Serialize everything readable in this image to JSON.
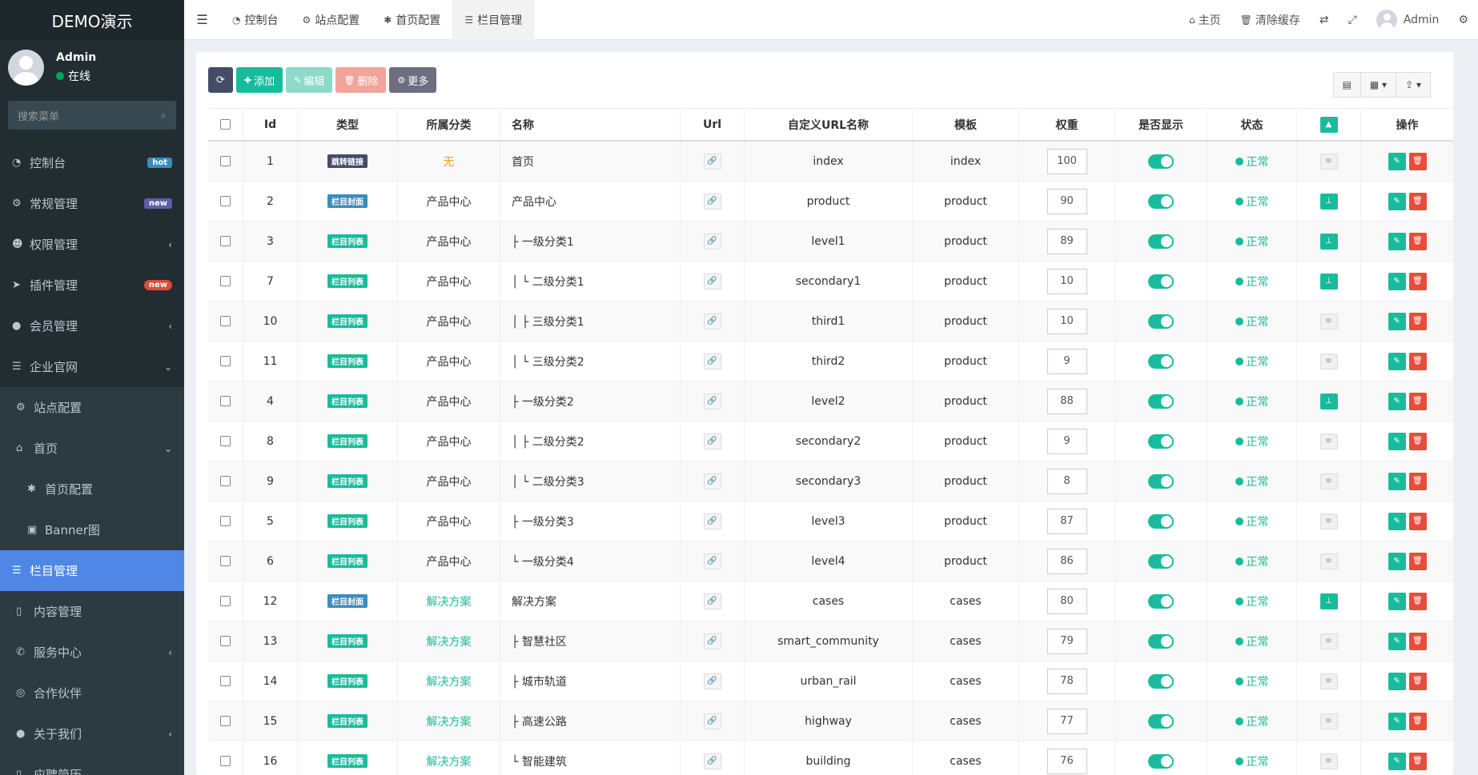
{
  "app": {
    "logo": "DEMO演示"
  },
  "user": {
    "name": "Admin",
    "status": "在线"
  },
  "search": {
    "placeholder": "搜索菜单"
  },
  "menu": [
    {
      "icon": "dashboard-icon",
      "glyph": "◔",
      "label": "控制台",
      "badge": "hot",
      "badge_color": "#3c8dbc",
      "type": "top"
    },
    {
      "icon": "cogs-icon",
      "glyph": "⚙",
      "label": "常规管理",
      "badge": "new",
      "badge_color": "#605ca8",
      "type": "top"
    },
    {
      "icon": "users-icon",
      "glyph": "☻",
      "label": "权限管理",
      "arrow": "‹",
      "type": "top"
    },
    {
      "icon": "rocket-icon",
      "glyph": "➤",
      "label": "插件管理",
      "badge": "new",
      "badge_color": "#dd4b39",
      "type": "top"
    },
    {
      "icon": "user-circle-icon",
      "glyph": "●",
      "label": "会员管理",
      "arrow": "‹",
      "type": "top"
    },
    {
      "icon": "list-icon",
      "glyph": "☰",
      "label": "企业官网",
      "arrow": "⌄",
      "type": "top-open"
    },
    {
      "icon": "cogs-icon",
      "glyph": "⚙",
      "label": "站点配置",
      "type": "sub"
    },
    {
      "icon": "home-icon",
      "glyph": "⌂",
      "label": "首页",
      "arrow": "⌄",
      "type": "sub"
    },
    {
      "icon": "gear-icon",
      "glyph": "✱",
      "label": "首页配置",
      "type": "sub2"
    },
    {
      "icon": "image-icon",
      "glyph": "▣",
      "label": "Banner图",
      "type": "sub2"
    },
    {
      "icon": "list-icon",
      "glyph": "☰",
      "label": "栏目管理",
      "type": "active"
    },
    {
      "icon": "file-icon",
      "glyph": "▯",
      "label": "内容管理",
      "type": "sub"
    },
    {
      "icon": "phone-icon",
      "glyph": "✆",
      "label": "服务中心",
      "arrow": "‹",
      "type": "sub"
    },
    {
      "icon": "handshake-icon",
      "glyph": "◎",
      "label": "合作伙伴",
      "type": "sub"
    },
    {
      "icon": "user-circle-icon",
      "glyph": "●",
      "label": "关于我们",
      "arrow": "‹",
      "type": "sub"
    },
    {
      "icon": "file-icon",
      "glyph": "▯",
      "label": "应聘简历",
      "type": "sub"
    }
  ],
  "topbar": {
    "tabs": [
      {
        "icon": "dashboard-icon",
        "glyph": "◔",
        "label": "控制台"
      },
      {
        "icon": "cogs-icon",
        "glyph": "⚙",
        "label": "站点配置"
      },
      {
        "icon": "gear-icon",
        "glyph": "✱",
        "label": "首页配置"
      },
      {
        "icon": "list-icon",
        "glyph": "☰",
        "label": "栏目管理",
        "active": true
      }
    ],
    "home": "主页",
    "clear_cache": "清除缓存",
    "admin": "Admin"
  },
  "toolbar": {
    "add": "添加",
    "edit": "编辑",
    "delete": "删除",
    "more": "更多"
  },
  "table": {
    "headers": [
      "Id",
      "类型",
      "所属分类",
      "名称",
      "Url",
      "自定义URL名称",
      "模板",
      "权重",
      "是否显示",
      "状态",
      "操作"
    ],
    "rows": [
      {
        "id": "1",
        "type": "跳转链接",
        "type_style": "dark",
        "category": "无",
        "cat_style": "none",
        "name": "首页",
        "url_name": "index",
        "template": "index",
        "weight": "100",
        "status": "正常",
        "has_children": false
      },
      {
        "id": "2",
        "type": "栏目封面",
        "type_style": "blue",
        "category": "产品中心",
        "cat_style": "plain",
        "name": "产品中心",
        "url_name": "product",
        "template": "product",
        "weight": "90",
        "status": "正常",
        "has_children": true
      },
      {
        "id": "3",
        "type": "栏目列表",
        "type_style": "green",
        "category": "产品中心",
        "cat_style": "plain",
        "name": "├ 一级分类1",
        "url_name": "level1",
        "template": "product",
        "weight": "89",
        "status": "正常",
        "has_children": true
      },
      {
        "id": "7",
        "type": "栏目列表",
        "type_style": "green",
        "category": "产品中心",
        "cat_style": "plain",
        "name": "│  └ 二级分类1",
        "url_name": "secondary1",
        "template": "product",
        "weight": "10",
        "status": "正常",
        "has_children": true
      },
      {
        "id": "10",
        "type": "栏目列表",
        "type_style": "green",
        "category": "产品中心",
        "cat_style": "plain",
        "name": "│    ├ 三级分类1",
        "url_name": "third1",
        "template": "product",
        "weight": "10",
        "status": "正常",
        "has_children": false
      },
      {
        "id": "11",
        "type": "栏目列表",
        "type_style": "green",
        "category": "产品中心",
        "cat_style": "plain",
        "name": "│    └ 三级分类2",
        "url_name": "third2",
        "template": "product",
        "weight": "9",
        "status": "正常",
        "has_children": false
      },
      {
        "id": "4",
        "type": "栏目列表",
        "type_style": "green",
        "category": "产品中心",
        "cat_style": "plain",
        "name": "├ 一级分类2",
        "url_name": "level2",
        "template": "product",
        "weight": "88",
        "status": "正常",
        "has_children": true
      },
      {
        "id": "8",
        "type": "栏目列表",
        "type_style": "green",
        "category": "产品中心",
        "cat_style": "plain",
        "name": "│  ├ 二级分类2",
        "url_name": "secondary2",
        "template": "product",
        "weight": "9",
        "status": "正常",
        "has_children": false
      },
      {
        "id": "9",
        "type": "栏目列表",
        "type_style": "green",
        "category": "产品中心",
        "cat_style": "plain",
        "name": "│  └ 二级分类3",
        "url_name": "secondary3",
        "template": "product",
        "weight": "8",
        "status": "正常",
        "has_children": false
      },
      {
        "id": "5",
        "type": "栏目列表",
        "type_style": "green",
        "category": "产品中心",
        "cat_style": "plain",
        "name": "├ 一级分类3",
        "url_name": "level3",
        "template": "product",
        "weight": "87",
        "status": "正常",
        "has_children": false
      },
      {
        "id": "6",
        "type": "栏目列表",
        "type_style": "green",
        "category": "产品中心",
        "cat_style": "plain",
        "name": "└ 一级分类4",
        "url_name": "level4",
        "template": "product",
        "weight": "86",
        "status": "正常",
        "has_children": false
      },
      {
        "id": "12",
        "type": "栏目封面",
        "type_style": "blue",
        "category": "解决方案",
        "cat_style": "teal",
        "name": "解决方案",
        "url_name": "cases",
        "template": "cases",
        "weight": "80",
        "status": "正常",
        "has_children": true
      },
      {
        "id": "13",
        "type": "栏目列表",
        "type_style": "green",
        "category": "解决方案",
        "cat_style": "teal",
        "name": "├ 智慧社区",
        "url_name": "smart_community",
        "template": "cases",
        "weight": "79",
        "status": "正常",
        "has_children": false
      },
      {
        "id": "14",
        "type": "栏目列表",
        "type_style": "green",
        "category": "解决方案",
        "cat_style": "teal",
        "name": "├ 城市轨道",
        "url_name": "urban_rail",
        "template": "cases",
        "weight": "78",
        "status": "正常",
        "has_children": false
      },
      {
        "id": "15",
        "type": "栏目列表",
        "type_style": "green",
        "category": "解决方案",
        "cat_style": "teal",
        "name": "├ 高速公路",
        "url_name": "highway",
        "template": "cases",
        "weight": "77",
        "status": "正常",
        "has_children": false
      },
      {
        "id": "16",
        "type": "栏目列表",
        "type_style": "green",
        "category": "解决方案",
        "cat_style": "teal",
        "name": "└ 智能建筑",
        "url_name": "building",
        "template": "cases",
        "weight": "76",
        "status": "正常",
        "has_children": false
      }
    ]
  }
}
